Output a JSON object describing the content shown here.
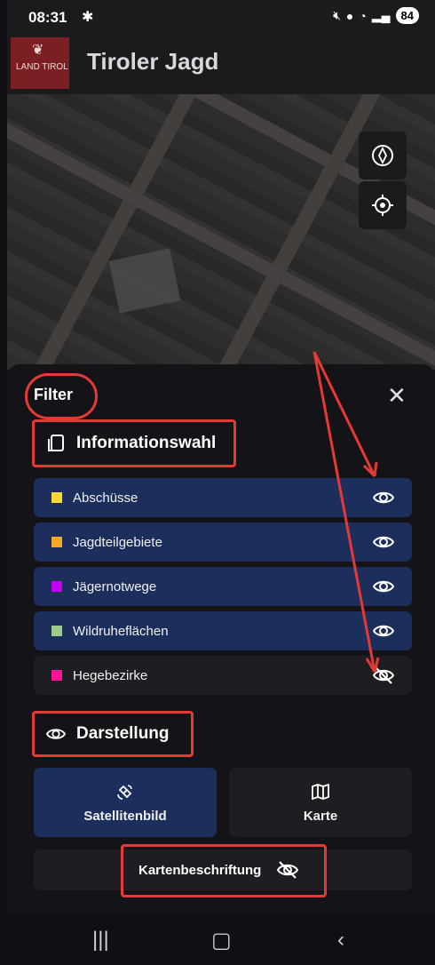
{
  "status_bar": {
    "time": "08:31",
    "battery": "84"
  },
  "app_bar": {
    "logo_text": "LAND TIROL",
    "title": "Tiroler Jagd"
  },
  "filter_panel": {
    "title": "Filter",
    "close_icon": "close-icon",
    "information_section": {
      "title": "Informationswahl",
      "layers": [
        {
          "label": "Abschüsse",
          "color": "#f5d633",
          "visible": true
        },
        {
          "label": "Jagdteilgebiete",
          "color": "#f5a623",
          "visible": true
        },
        {
          "label": "Jägernotwege",
          "color": "#c800f0",
          "visible": true
        },
        {
          "label": "Wildruheflächen",
          "color": "#9ccc8c",
          "visible": true
        },
        {
          "label": "Hegebezirke",
          "color": "#ff1493",
          "visible": false
        }
      ]
    },
    "display_section": {
      "title": "Darstellung",
      "modes": [
        {
          "label": "Satellitenbild",
          "icon": "satellite-icon",
          "selected": true
        },
        {
          "label": "Karte",
          "icon": "map-icon",
          "selected": false
        }
      ],
      "labels_toggle": {
        "label": "Kartenbeschriftung",
        "visible": false
      }
    }
  },
  "map_controls": [
    "compass-icon",
    "locate-icon"
  ],
  "nav_bar": [
    "recents-button",
    "home-button",
    "back-button"
  ]
}
